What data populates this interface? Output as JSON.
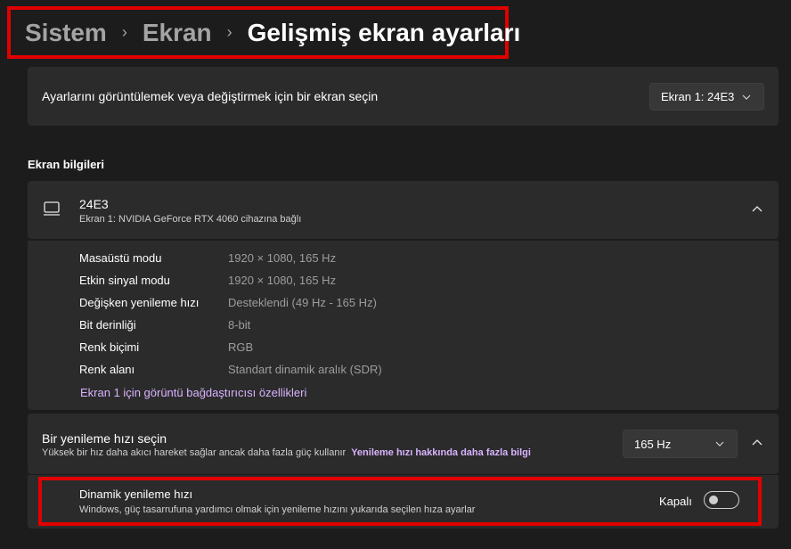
{
  "breadcrumb": {
    "items": [
      "Sistem",
      "Ekran"
    ],
    "current": "Gelişmiş ekran ayarları",
    "separator": "›"
  },
  "display_select": {
    "label": "Ayarlarını görüntülemek veya değiştirmek için bir ekran seçin",
    "value": "Ekran 1: 24E3"
  },
  "display_info": {
    "section_title": "Ekran bilgileri",
    "monitor_name": "24E3",
    "monitor_subtitle": "Ekran 1: NVIDIA GeForce RTX 4060 cihazına bağlı",
    "rows": [
      {
        "label": "Masaüstü modu",
        "value": "1920 × 1080, 165 Hz"
      },
      {
        "label": "Etkin sinyal modu",
        "value": "1920 × 1080, 165 Hz"
      },
      {
        "label": "Değişken yenileme hızı",
        "value": "Desteklendi (49 Hz - 165 Hz)"
      },
      {
        "label": "Bit derinliği",
        "value": "8-bit"
      },
      {
        "label": "Renk biçimi",
        "value": "RGB"
      },
      {
        "label": "Renk alanı",
        "value": "Standart dinamik aralık (SDR)"
      }
    ],
    "adapter_link": "Ekran 1 için görüntü bağdaştırıcısı özellikleri"
  },
  "refresh_rate": {
    "title": "Bir yenileme hızı seçin",
    "subtitle": "Yüksek bir hız daha akıcı hareket sağlar ancak daha fazla güç kullanır",
    "learn_more_link": "Yenileme hızı hakkında daha fazla bilgi",
    "value": "165 Hz"
  },
  "dynamic_refresh": {
    "title": "Dinamik yenileme hızı",
    "subtitle": "Windows, güç tasarrufuna yardımcı olmak için yenileme hızını yukarıda seçilen hıza ayarlar",
    "toggle_label": "Kapalı",
    "enabled": false
  },
  "colors": {
    "background": "#1c1c1c",
    "card": "#2b2b2b",
    "highlight_border": "#e10000",
    "link": "#d9b3ff"
  }
}
